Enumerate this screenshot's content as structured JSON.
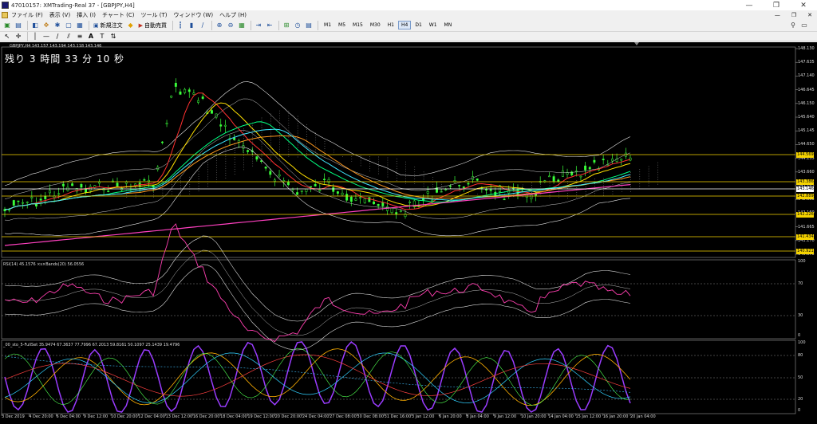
{
  "window": {
    "title": "47010157: XMTrading-Real 37 - [GBPJPY,H4]",
    "buttons": [
      "—",
      "❐",
      "✕"
    ]
  },
  "menu": {
    "items": [
      "ファイル (F)",
      "表示 (V)",
      "挿入 (I)",
      "チャート (C)",
      "ツール (T)",
      "ウィンドウ (W)",
      "ヘルプ (H)"
    ],
    "mdi_buttons": [
      "—",
      "❐",
      "✕"
    ]
  },
  "toolbar": {
    "new_order": "新規注文",
    "auto_trade": "自動売買",
    "timeframes": [
      "M1",
      "M5",
      "M15",
      "M30",
      "H1",
      "H4",
      "D1",
      "W1",
      "MN"
    ],
    "active_timeframe": "H4"
  },
  "chart": {
    "symbol_header": "GBPJPY,H4  143.157 143.194 143.118 143.146",
    "countdown": "残り 3 時間 33 分 10 秒",
    "rsi_header": "RSI(14) 45.1576   ×s×Bands(20) 56.0556",
    "sto_header": "_00_sto_5-FullSet 35.9474 67.3637 77.7996 67.2013 59.8161 50.1097 25.1439 19.4796",
    "price_axis": [
      "148.130",
      "147.635",
      "147.140",
      "146.645",
      "146.150",
      "145.640",
      "145.145",
      "144.650",
      "144.155",
      "143.660",
      "143.165",
      "142.655",
      "142.160",
      "141.665",
      "141.170",
      "140.675"
    ],
    "price_tags": [
      {
        "text": "144.569",
        "bg": "#f5d300",
        "color": "#000"
      },
      {
        "text": "143.386",
        "bg": "#f5d300",
        "color": "#000"
      },
      {
        "text": "143.146",
        "bg": "#ffffff",
        "color": "#000"
      },
      {
        "text": "142.889",
        "bg": "#f5d300",
        "color": "#000"
      },
      {
        "text": "142.226",
        "bg": "#f5d300",
        "color": "#000"
      },
      {
        "text": "141.434",
        "bg": "#f5d300",
        "color": "#000"
      },
      {
        "text": "140.921",
        "bg": "#f5d300",
        "color": "#000"
      }
    ],
    "rsi_axis": [
      "70",
      "30",
      "0"
    ],
    "rsi_top": "100",
    "sto_axis": [
      "100",
      "80",
      "50",
      "20",
      "0"
    ],
    "dates": [
      "3 Dec 2019",
      "4 Dec 20:00",
      "6 Dec 04:00",
      "9 Dec 12:00",
      "10 Dec 20:00",
      "12 Dec 04:00",
      "13 Dec 12:00",
      "16 Dec 20:00",
      "18 Dec 04:00",
      "19 Dec 12:00",
      "20 Dec 20:00",
      "24 Dec 04:00",
      "27 Dec 08:00",
      "30 Dec 08:00",
      "31 Dec 16:00",
      "3 Jan 12:00",
      "6 Jan 20:00",
      "8 Jan 04:00",
      "9 Jan 12:00",
      "10 Jan 20:00",
      "14 Jan 04:00",
      "15 Jan 12:00",
      "16 Jan 20:00",
      "20 Jan 04:00"
    ]
  }
}
